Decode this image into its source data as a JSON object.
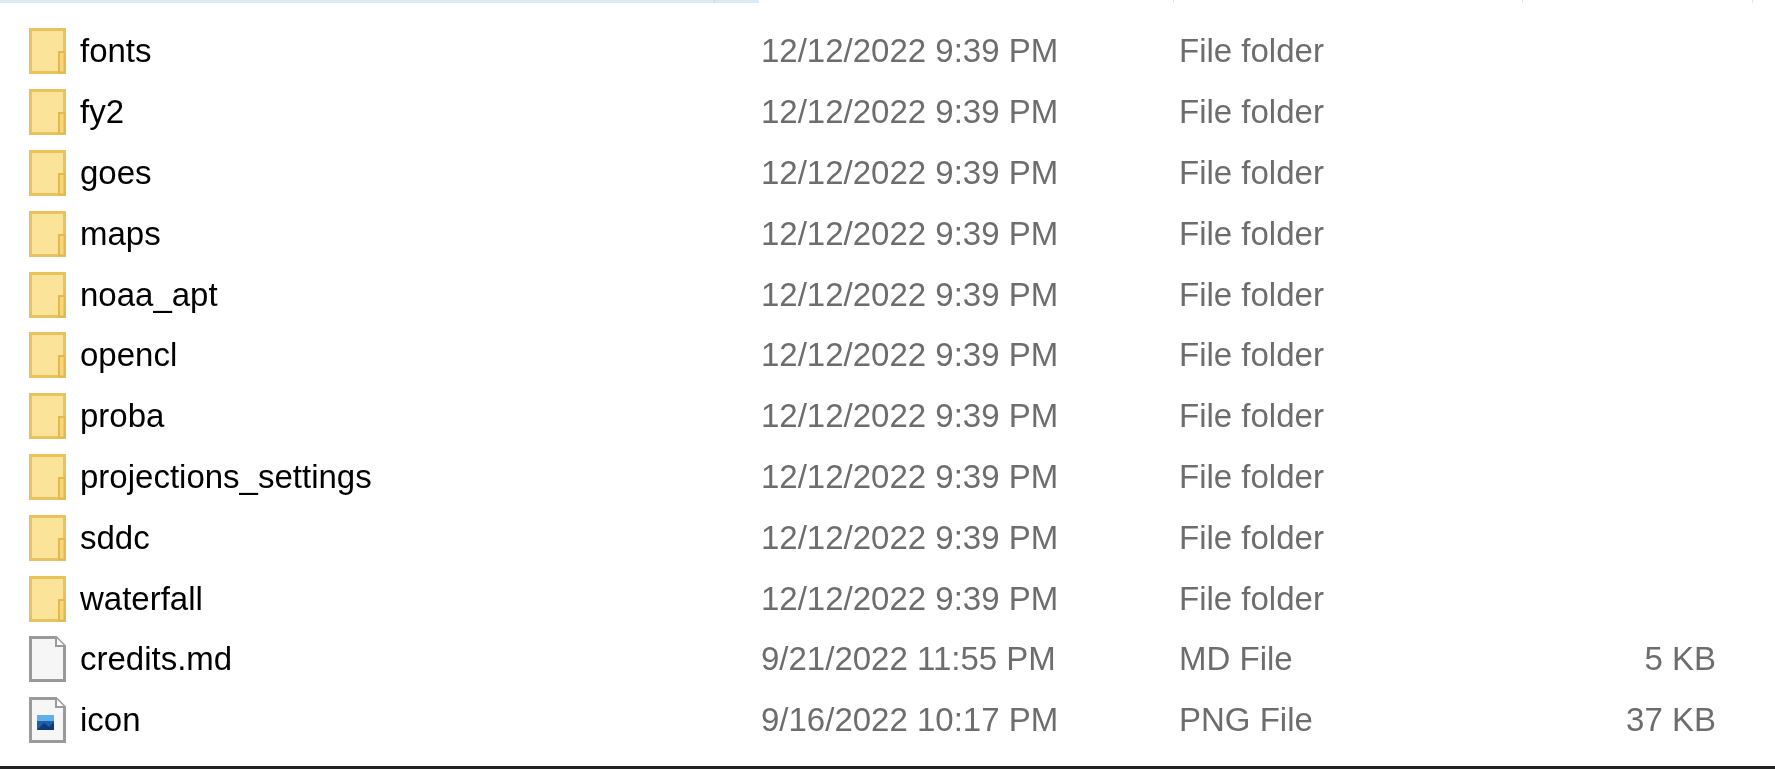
{
  "files": [
    {
      "kind": "folder",
      "name": "fonts",
      "date_modified": "12/12/2022 9:39 PM",
      "type": "File folder"
    },
    {
      "kind": "folder",
      "name": "fy2",
      "date_modified": "12/12/2022 9:39 PM",
      "type": "File folder"
    },
    {
      "kind": "folder",
      "name": "goes",
      "date_modified": "12/12/2022 9:39 PM",
      "type": "File folder"
    },
    {
      "kind": "folder",
      "name": "maps",
      "date_modified": "12/12/2022 9:39 PM",
      "type": "File folder"
    },
    {
      "kind": "folder",
      "name": "noaa_apt",
      "date_modified": "12/12/2022 9:39 PM",
      "type": "File folder"
    },
    {
      "kind": "folder",
      "name": "opencl",
      "date_modified": "12/12/2022 9:39 PM",
      "type": "File folder"
    },
    {
      "kind": "folder",
      "name": "proba",
      "date_modified": "12/12/2022 9:39 PM",
      "type": "File folder"
    },
    {
      "kind": "folder",
      "name": "projections_settings",
      "date_modified": "12/12/2022 9:39 PM",
      "type": "File folder"
    },
    {
      "kind": "folder",
      "name": "sddc",
      "date_modified": "12/12/2022 9:39 PM",
      "type": "File folder"
    },
    {
      "kind": "folder",
      "name": "waterfall",
      "date_modified": "12/12/2022 9:39 PM",
      "type": "File folder"
    },
    {
      "kind": "document",
      "name": "credits.md",
      "date_modified": "9/21/2022 11:55 PM",
      "type": "MD File",
      "size": "5 KB"
    },
    {
      "kind": "image",
      "name": "icon",
      "date_modified": "9/16/2022 10:17 PM",
      "type": "PNG File",
      "size": "37 KB"
    }
  ]
}
